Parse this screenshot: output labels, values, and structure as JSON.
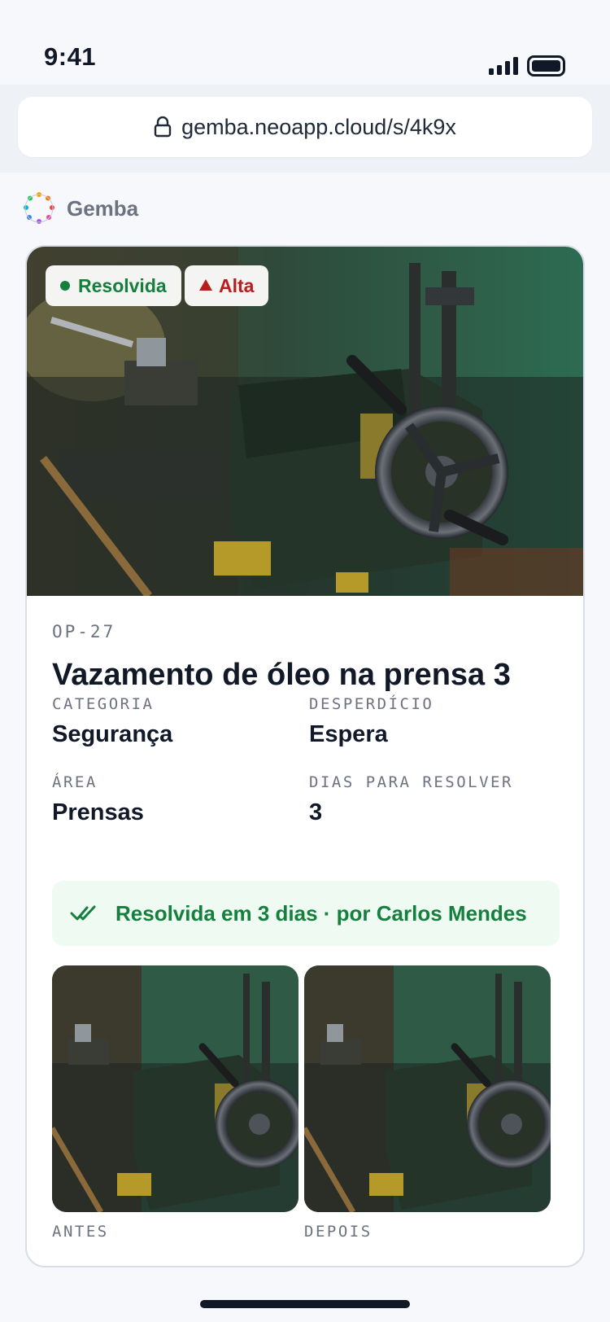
{
  "status_bar": {
    "time": "9:41"
  },
  "browser": {
    "url": "gemba.neoapp.cloud/s/4k9x"
  },
  "brand": {
    "name": "Gemba"
  },
  "issue": {
    "status": "Resolvida",
    "priority": "Alta",
    "code": "OP-27",
    "title": "Vazamento de óleo na prensa 3",
    "fields": [
      {
        "label": "CATEGORIA",
        "value": "Segurança"
      },
      {
        "label": "DESPERDÍCIO",
        "value": "Espera"
      },
      {
        "label": "ÁREA",
        "value": "Prensas"
      },
      {
        "label": "DIAS PARA RESOLVER",
        "value": "3"
      }
    ],
    "resolution": "Resolvida em 3 dias · por Carlos Mendes",
    "photos": [
      {
        "label": "ANTES"
      },
      {
        "label": "DEPOIS"
      }
    ]
  },
  "colors": {
    "success": "#15803d",
    "danger": "#b91c1c",
    "success_bg": "#effbf2"
  }
}
